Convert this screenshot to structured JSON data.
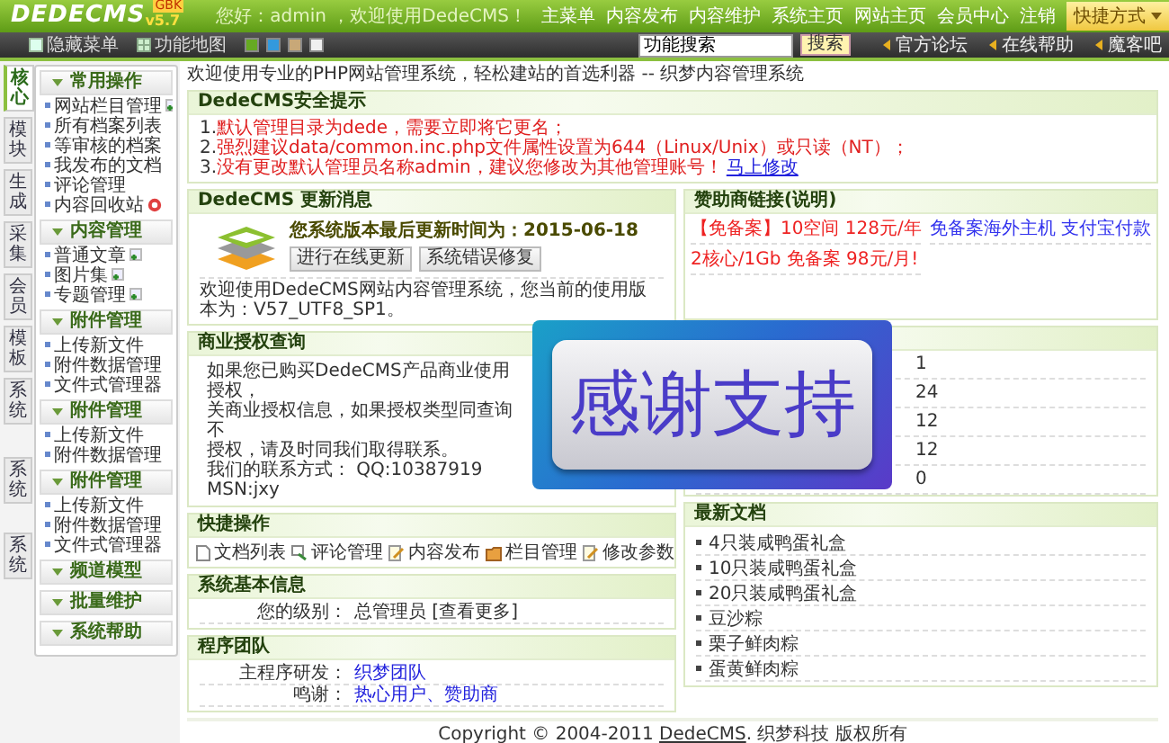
{
  "header": {
    "logo": "DEDECMS",
    "version": "v5.7",
    "edition": "GBK",
    "greeting": "您好：admin ，欢迎使用DedeCMS！",
    "nav": [
      "主菜单",
      "内容发布",
      "内容维护",
      "系统主页",
      "网站主页",
      "会员中心",
      "注销"
    ],
    "shortcut": "快捷方式"
  },
  "toolbar": {
    "hide_menu": "隐藏菜单",
    "map": "功能地图",
    "themes": [
      {
        "color": "#66aa22"
      },
      {
        "color": "#3399dd"
      },
      {
        "color": "#c8a878"
      },
      {
        "color": "#f0f0f0"
      }
    ],
    "search": {
      "value": "功能搜索",
      "button": "搜索"
    },
    "links": [
      "官方论坛",
      "在线帮助",
      "魔客吧"
    ]
  },
  "sidebar": {
    "tabs": [
      {
        "label": "核心",
        "selected": true
      },
      {
        "label": "模块",
        "selected": false
      },
      {
        "label": "生成",
        "selected": false
      },
      {
        "label": "采集",
        "selected": false
      },
      {
        "label": "会员",
        "selected": false
      },
      {
        "label": "模板",
        "selected": false
      },
      {
        "label": "系统",
        "selected": false
      },
      {
        "label": "系统",
        "selected": false
      },
      {
        "label": "系统",
        "selected": false
      }
    ],
    "groups": [
      {
        "title": "常用操作",
        "items": [
          {
            "label": "网站栏目管理",
            "kind": "add"
          },
          {
            "label": "所有档案列表",
            "kind": "plain"
          },
          {
            "label": "等审核的档案",
            "kind": "plain"
          },
          {
            "label": "我发布的文档",
            "kind": "plain"
          },
          {
            "label": "评论管理",
            "kind": "plain"
          },
          {
            "label": "内容回收站",
            "kind": "trash"
          }
        ]
      },
      {
        "title": "内容管理",
        "items": [
          {
            "label": "普通文章",
            "kind": "add"
          },
          {
            "label": "图片集",
            "kind": "add"
          },
          {
            "label": "专题管理",
            "kind": "add"
          }
        ]
      },
      {
        "title": "附件管理",
        "items": [
          {
            "label": "上传新文件",
            "kind": "plain"
          },
          {
            "label": "附件数据管理",
            "kind": "plain"
          },
          {
            "label": "文件式管理器",
            "kind": "plain"
          }
        ]
      },
      {
        "title": "附件管理",
        "items": [
          {
            "label": "上传新文件",
            "kind": "plain"
          },
          {
            "label": "附件数据管理",
            "kind": "plain"
          }
        ]
      },
      {
        "title": "附件管理",
        "items": [
          {
            "label": "上传新文件",
            "kind": "plain"
          },
          {
            "label": "附件数据管理",
            "kind": "plain"
          },
          {
            "label": "文件式管理器",
            "kind": "plain"
          }
        ]
      },
      {
        "title": "频道模型"
      },
      {
        "title": "批量维护"
      },
      {
        "title": "系统帮助"
      }
    ]
  },
  "welcome": "欢迎使用专业的PHP网站管理系统，轻松建站的首选利器 -- 织梦内容管理系统",
  "security": {
    "title": "DedeCMS安全提示",
    "lines": [
      {
        "number": "1.",
        "text": "默认管理目录为dede，需要立即将它更名；"
      },
      {
        "number": "2.",
        "text": "强烈建议data/common.inc.php文件属性设置为644（Linux/Unix）或只读（NT）；"
      },
      {
        "number": "3.",
        "text": "没有更改默认管理员名称admin，建议您修改为其他管理账号！",
        "link": "马上修改"
      }
    ]
  },
  "update": {
    "title": "DedeCMS 更新消息",
    "date_line": "您系统版本最后更新时间为：2015-06-18",
    "buttons": [
      "进行在线更新",
      "系统错误修复"
    ],
    "text": "欢迎使用DedeCMS网站内容管理系统，您当前的使用版本为：V57_UTF8_SP1。"
  },
  "license": {
    "title": "商业授权查询",
    "lines": [
      "如果您已购买DedeCMS产品商业使用授权，",
      "关商业授权信息，如果授权类型同查询不",
      "授权，请及时同我们取得联系。",
      "我们的联系方式： QQ:10387919 MSN:jxy"
    ]
  },
  "quick": {
    "title": "快捷操作",
    "items": [
      {
        "label": "文档列表",
        "kind": "doc"
      },
      {
        "label": "评论管理",
        "kind": "comment"
      },
      {
        "label": "内容发布",
        "kind": "edit"
      },
      {
        "label": "栏目管理",
        "kind": "folder"
      },
      {
        "label": "修改参数",
        "kind": "edit"
      }
    ]
  },
  "sysinfo": {
    "title": "系统基本信息",
    "rows": [
      {
        "label": "您的级别：",
        "value": "总管理员 [查看更多]"
      }
    ]
  },
  "team": {
    "title": "程序团队",
    "rows": [
      {
        "label": "主程序研发：",
        "link": "织梦团队"
      },
      {
        "label": "鸣谢：",
        "link": "热心用户、赞助商"
      }
    ]
  },
  "sponsors": {
    "title": "赞助商链接(说明)",
    "links": [
      {
        "text": "【免备案】10空间 128元/年",
        "color": "#ee2222"
      },
      {
        "text": "免备案海外主机 支付宝付款",
        "color": "#3333ee"
      },
      {
        "text": "2核心/1Gb 免备案 98元/月!",
        "color": "#ee2222"
      }
    ]
  },
  "stats": {
    "values": [
      "1",
      "24",
      "12",
      "12",
      "0"
    ]
  },
  "latest": {
    "title": "最新文档",
    "items": [
      "4只装咸鸭蛋礼盒",
      "10只装咸鸭蛋礼盒",
      "20只装咸鸭蛋礼盒",
      "豆沙粽",
      "栗子鲜肉粽",
      "蛋黄鲜肉粽"
    ]
  },
  "banner": {
    "text": "感谢支持"
  },
  "footer": {
    "pre": "Copyright © 2004-2011 ",
    "link": "DedeCMS",
    "post": ". 织梦科技 版权所有"
  }
}
